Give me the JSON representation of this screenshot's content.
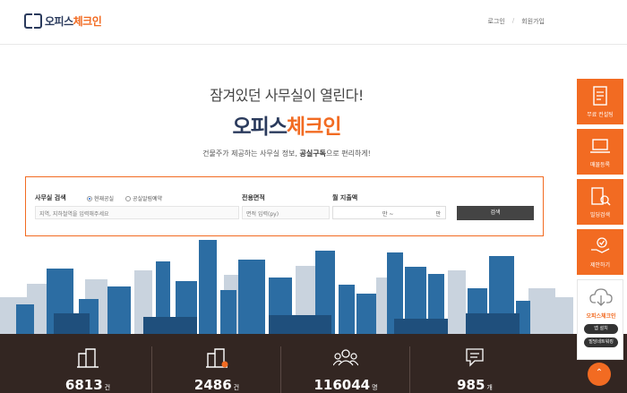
{
  "header": {
    "logo_main": "오피스",
    "logo_accent": "체크인",
    "nav": {
      "login": "로그인",
      "signup": "회원가입",
      "separator": "/"
    }
  },
  "hero": {
    "subtitle": "잠겨있던 사무실이 열린다!",
    "title_main": "오피스",
    "title_accent": "체크인",
    "desc_prefix": "건물주가 제공하는 사무실 정보, ",
    "desc_bold": "공실구독",
    "desc_suffix": "으로 편리하게!"
  },
  "search": {
    "office_label": "사무실 검색",
    "radio_current": "현재공실",
    "radio_reserve": "공실알림예약",
    "area_label": "전용면적",
    "rent_label": "월 지출액",
    "location_placeholder": "지역, 지하철역을 입력해주세요",
    "area_placeholder": "면적 입력(py)",
    "price_from": "만 ~",
    "price_to": "만",
    "button": "검색"
  },
  "stats": [
    {
      "value": "6813",
      "unit": "건",
      "icon": "building-icon"
    },
    {
      "value": "2486",
      "unit": "건",
      "icon": "building-new-icon"
    },
    {
      "value": "116044",
      "unit": "명",
      "icon": "users-icon"
    },
    {
      "value": "985",
      "unit": "개",
      "icon": "chat-icon"
    }
  ],
  "rail": {
    "items": [
      {
        "label": "무료 컨설팅",
        "icon": "consulting-icon"
      },
      {
        "label": "매물등록",
        "icon": "laptop-icon"
      },
      {
        "label": "빌딩검색",
        "icon": "building-search-icon"
      },
      {
        "label": "제안하기",
        "icon": "hand-check-icon"
      }
    ],
    "app_brand": "오피스체크인",
    "app_install": "앱 설치",
    "app_tag": "빌딩네트워킹"
  },
  "colors": {
    "accent": "#f26b22",
    "navy": "#2a3a5c",
    "stats_bg": "#332622"
  }
}
